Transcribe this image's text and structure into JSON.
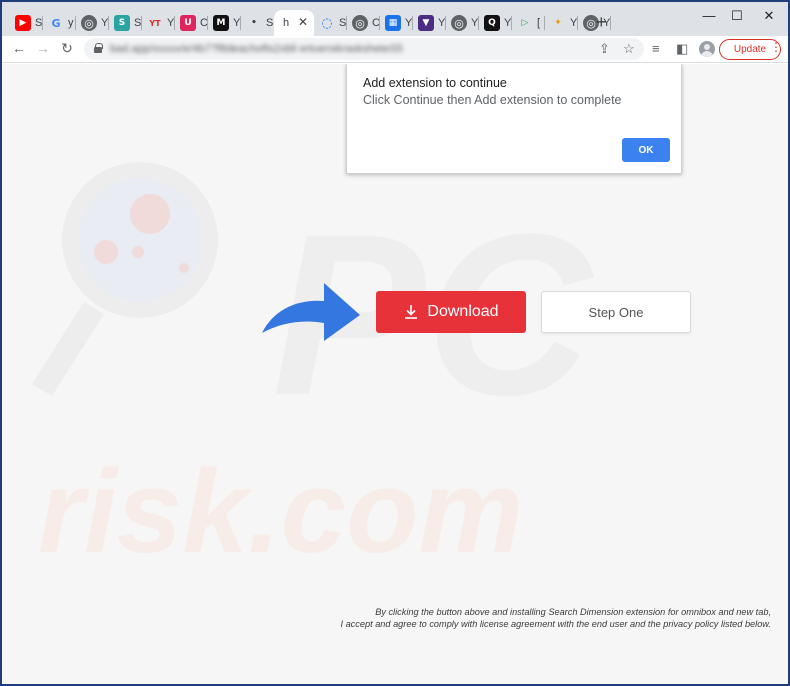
{
  "tabs": [
    {
      "icon": "youtube-icon",
      "glyph": "▶",
      "title": "S",
      "color": "#ff0000"
    },
    {
      "icon": "google-icon",
      "glyph": "G",
      "title": "y",
      "color": "#ffffff"
    },
    {
      "icon": "globe-icon",
      "glyph": "◎",
      "title": "Y",
      "color": "#5f6368"
    },
    {
      "icon": "swirl-icon",
      "glyph": "S",
      "title": "S",
      "color": "#2aa3a1"
    },
    {
      "icon": "yt-text-icon",
      "glyph": "YT",
      "title": "Y",
      "color": "#ffffff"
    },
    {
      "icon": "pocket-icon",
      "glyph": "U",
      "title": "C",
      "color": "#e0245e"
    },
    {
      "icon": "news-icon",
      "glyph": "M",
      "title": "Y",
      "color": "#111111"
    },
    {
      "icon": "blank-icon",
      "glyph": "•",
      "title": "S",
      "color": "#dee1e6"
    },
    {
      "icon": "active-tab-icon",
      "glyph": "",
      "title": "h",
      "color": "#ffffff"
    },
    {
      "icon": "loading-icon",
      "glyph": "◌",
      "title": "S",
      "color": "#ffffff"
    },
    {
      "icon": "globe-icon",
      "glyph": "◎",
      "title": "C",
      "color": "#5f6368"
    },
    {
      "icon": "apps-icon",
      "glyph": "▦",
      "title": "Y",
      "color": "#1a73e8"
    },
    {
      "icon": "bookmark-icon",
      "glyph": "▼",
      "title": "Y",
      "color": "#4b2c82"
    },
    {
      "icon": "globe-icon",
      "glyph": "◎",
      "title": "Y",
      "color": "#5f6368"
    },
    {
      "icon": "q-icon",
      "glyph": "Q",
      "title": "Y",
      "color": "#111111"
    },
    {
      "icon": "play-icon",
      "glyph": "▷",
      "title": "[",
      "color": "#ffffff"
    },
    {
      "icon": "pinwheel-icon",
      "glyph": "✦",
      "title": "Y",
      "color": "#ffffff"
    },
    {
      "icon": "globe-icon",
      "glyph": "◎",
      "title": "Y",
      "color": "#5f6368"
    }
  ],
  "toolbar": {
    "url": "bad.app/xxxxx/e/4b7?f8deachofts2xbli ertuenskrasksheteS5",
    "update_label": "Update"
  },
  "dialog": {
    "title": "Add extension to continue",
    "message": "Click Continue then Add extension to complete",
    "ok_label": "OK"
  },
  "main": {
    "download_label": "Download",
    "step_one_label": "Step One",
    "disclaimer_line1": "By clicking the button above and installing Search Dimension extension for omnibox and new tab,",
    "disclaimer_line2": "I accept and agree to comply with license agreement with the end user and the privacy policy listed below."
  },
  "watermark": {
    "line1": "PC",
    "line2": "risk.com"
  },
  "colors": {
    "download": "#e8323a",
    "dialog_ok": "#3b82f0",
    "arrow": "#3477e0",
    "update": "#d93025"
  }
}
